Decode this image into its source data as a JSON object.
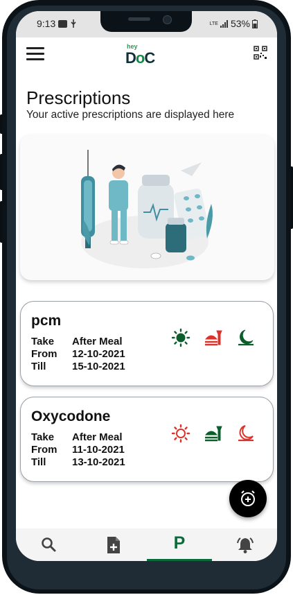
{
  "status_bar": {
    "time": "9:13",
    "network": "LTE",
    "battery": "53%"
  },
  "app": {
    "logo_small": "hey",
    "logo_big_prefix": "D",
    "logo_big_accent": "o",
    "logo_big_suffix": "C"
  },
  "header": {
    "title": "Prescriptions",
    "subtitle": "Your active prescriptions are displayed here"
  },
  "prescriptions": [
    {
      "name": "pcm",
      "take_label": "Take",
      "take_value": "After Meal",
      "from_label": "From",
      "from_value": "12-10-2021",
      "till_label": "Till",
      "till_value": "15-10-2021",
      "morning": true,
      "afternoon": false,
      "night": true
    },
    {
      "name": "Oxycodone",
      "take_label": "Take",
      "take_value": "After Meal",
      "from_label": "From",
      "from_value": "11-10-2021",
      "till_label": "Till",
      "till_value": "13-10-2021",
      "morning": false,
      "afternoon": true,
      "night": false
    }
  ],
  "colors": {
    "active": "#0a5e2c",
    "inactive": "#d9332b",
    "brand": "#0a6b3a"
  },
  "icons": {
    "menu": "menu-icon",
    "qr": "qr-scanner-icon",
    "morning": "sun-icon",
    "afternoon": "meal-icon",
    "night": "moon-icon",
    "fab": "add-alarm-icon",
    "nav_search": "search-icon",
    "nav_add": "add-document-icon",
    "nav_prescriptions": "P",
    "nav_alerts": "bell-icon"
  }
}
